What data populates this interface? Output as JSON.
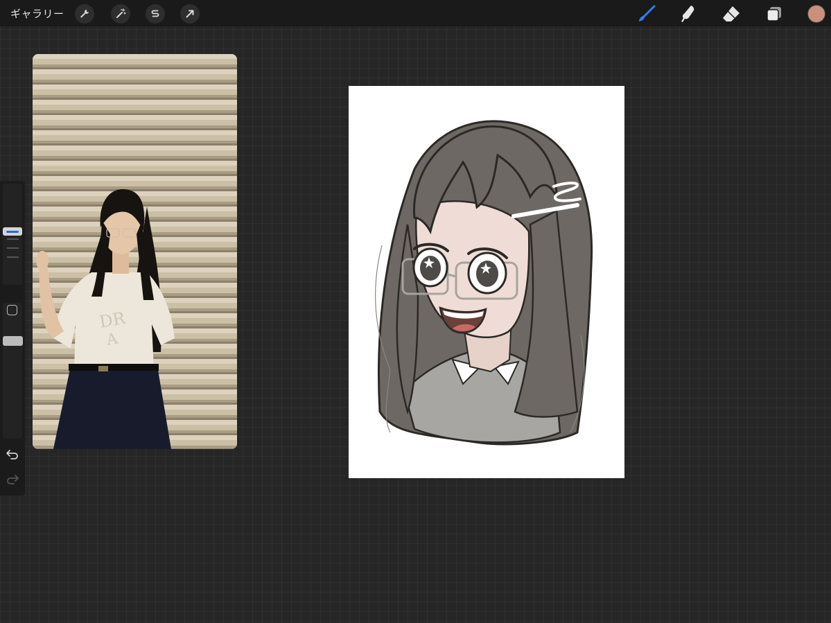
{
  "toolbar": {
    "gallery_label": "ギャラリー",
    "left_tools": [
      "wrench-icon",
      "magic-wand-icon",
      "selection-icon",
      "transform-arrow-icon"
    ],
    "right_tools": [
      "brush-icon",
      "smudge-icon",
      "eraser-icon",
      "layers-icon"
    ],
    "active_tool": "brush-icon",
    "active_color": "#c9917c",
    "accent": "#1f6fe0"
  },
  "sidebar": {
    "controls": [
      "brush-size-slider",
      "modify-button",
      "opacity-slider",
      "undo-icon",
      "redo-icon"
    ]
  },
  "reference": {
    "subject": "reference-photo"
  },
  "canvas": {
    "content": "anime-girl-drawing",
    "background": "#ffffff"
  }
}
